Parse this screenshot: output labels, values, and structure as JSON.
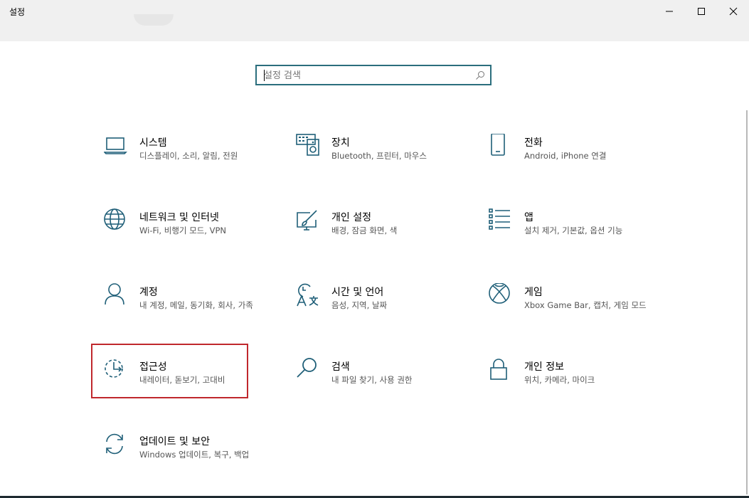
{
  "window": {
    "title": "설정"
  },
  "search": {
    "placeholder": "설정 검색"
  },
  "tiles": [
    {
      "name": "시스템",
      "desc": "디스플레이, 소리, 알림, 전원",
      "icon": "laptop-icon"
    },
    {
      "name": "장치",
      "desc": "Bluetooth, 프린터, 마우스",
      "icon": "keyboard-speaker-icon"
    },
    {
      "name": "전화",
      "desc": "Android, iPhone 연결",
      "icon": "phone-icon"
    },
    {
      "name": "네트워크 및 인터넷",
      "desc": "Wi-Fi, 비행기 모드, VPN",
      "icon": "globe-icon"
    },
    {
      "name": "개인 설정",
      "desc": "배경, 잠금 화면, 색",
      "icon": "paint-brush-icon"
    },
    {
      "name": "앱",
      "desc": "설치 제거, 기본값, 옵션 기능",
      "icon": "apps-list-icon"
    },
    {
      "name": "계정",
      "desc": "내 계정, 메일, 동기화, 회사, 가족",
      "icon": "person-icon"
    },
    {
      "name": "시간 및 언어",
      "desc": "음성, 지역, 날짜",
      "icon": "time-language-icon"
    },
    {
      "name": "게임",
      "desc": "Xbox Game Bar, 캡처, 게임 모드",
      "icon": "xbox-icon"
    },
    {
      "name": "접근성",
      "desc": "내레이터, 돋보기, 고대비",
      "icon": "accessibility-icon"
    },
    {
      "name": "검색",
      "desc": "내 파일 찾기, 사용 권한",
      "icon": "magnifier-icon"
    },
    {
      "name": "개인 정보",
      "desc": "위치, 카메라, 마이크",
      "icon": "lock-icon"
    },
    {
      "name": "업데이트 및 보안",
      "desc": "Windows 업데이트, 복구, 백업",
      "icon": "sync-icon"
    }
  ],
  "colors": {
    "icon": "#1f5f78",
    "search_border": "#2b6e7d",
    "highlight": "#c0282d"
  }
}
